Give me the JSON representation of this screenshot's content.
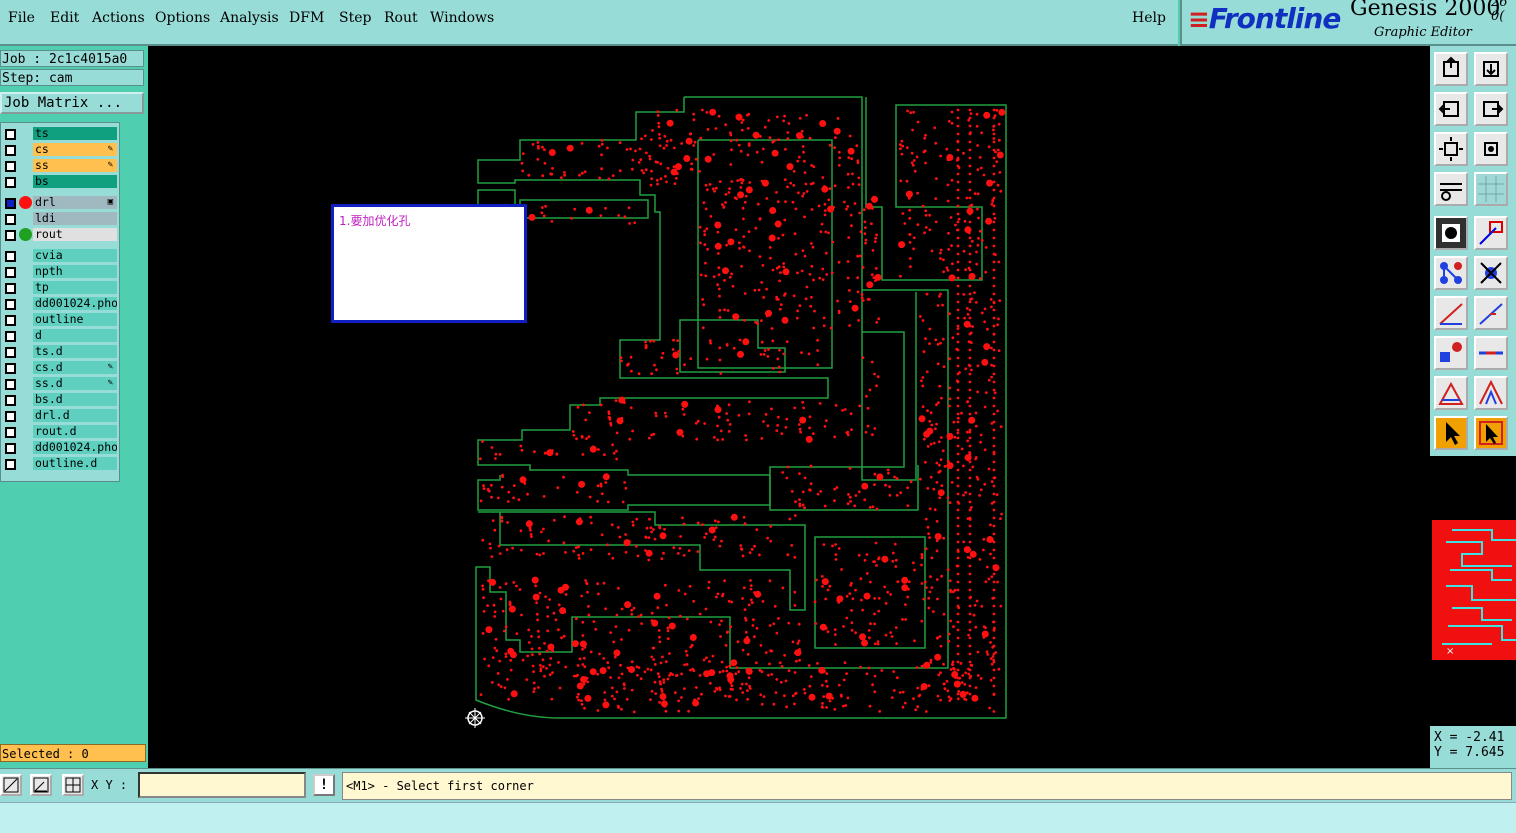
{
  "menubar": {
    "items": [
      "File",
      "Edit",
      "Actions",
      "Options",
      "Analysis",
      "DFM",
      "Step",
      "Rout",
      "Windows"
    ],
    "help": "Help"
  },
  "brand": {
    "logo": "Frontline",
    "product": "Genesis 2000",
    "subtitle": "Graphic Editor",
    "version_top": "26",
    "version_bottom": "0("
  },
  "job": {
    "job_line": "Job : 2c1c4015a0",
    "step_line": "Step: cam",
    "matrix_button": "Job Matrix ..."
  },
  "layers": [
    {
      "name": "ts",
      "color": "#10a080",
      "mark": ""
    },
    {
      "name": "cs",
      "color": "#ffc050",
      "mark": "✎"
    },
    {
      "name": "ss",
      "color": "#ffc050",
      "mark": "✎"
    },
    {
      "name": "bs",
      "color": "#10a080",
      "mark": ""
    },
    {
      "name": "drl",
      "color": "#a0b8c0",
      "mark": "▣",
      "dot": "#ff1010",
      "active": true
    },
    {
      "name": "ldi",
      "color": "#a0b8c0",
      "mark": ""
    },
    {
      "name": "rout",
      "color": "#e0e0e0",
      "mark": "",
      "dot": "#20a020"
    },
    {
      "name": "cvia",
      "color": "#5fd0c0",
      "mark": ""
    },
    {
      "name": "npth",
      "color": "#5fd0c0",
      "mark": ""
    },
    {
      "name": "tp",
      "color": "#5fd0c0",
      "mark": ""
    },
    {
      "name": "dd001024.pho",
      "color": "#5fd0c0",
      "mark": ""
    },
    {
      "name": "outline",
      "color": "#5fd0c0",
      "mark": ""
    },
    {
      "name": "d",
      "color": "#5fd0c0",
      "mark": ""
    },
    {
      "name": "ts.d",
      "color": "#5fd0c0",
      "mark": ""
    },
    {
      "name": "cs.d",
      "color": "#5fd0c0",
      "mark": "✎"
    },
    {
      "name": "ss.d",
      "color": "#5fd0c0",
      "mark": "✎"
    },
    {
      "name": "bs.d",
      "color": "#5fd0c0",
      "mark": ""
    },
    {
      "name": "drl.d",
      "color": "#5fd0c0",
      "mark": ""
    },
    {
      "name": "rout.d",
      "color": "#5fd0c0",
      "mark": ""
    },
    {
      "name": "dd001024.pho",
      "color": "#5fd0c0",
      "mark": ""
    },
    {
      "name": "outline.d",
      "color": "#5fd0c0",
      "mark": ""
    }
  ],
  "selected": "Selected : 0",
  "note": "1.要加优化孔",
  "coords": {
    "x": "X = -2.41",
    "y": "Y = 7.645"
  },
  "status": {
    "xy_label": "X Y :",
    "xy_value": "",
    "prompt": "<M1> - Select first corner"
  },
  "colors": {
    "pad": "#ff1010",
    "outline": "#20a040",
    "panel": "#98dcd8"
  }
}
